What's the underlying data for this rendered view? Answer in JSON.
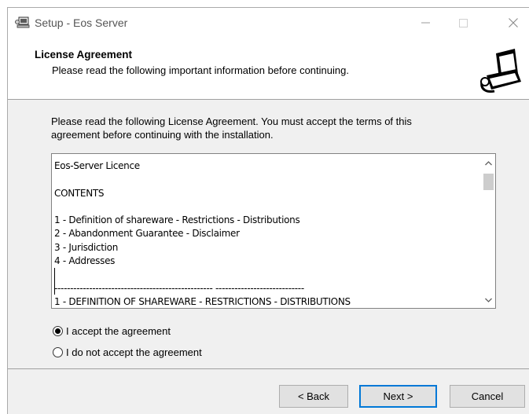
{
  "window": {
    "title": "Setup - Eos Server"
  },
  "header": {
    "title": "License Agreement",
    "subtitle": "Please read the following important information before continuing."
  },
  "intro": {
    "line1": "Please read the following License Agreement. You must accept the terms of this",
    "line2": "agreement before continuing with the installation."
  },
  "license_text": [
    "Eos-Server Licence",
    "",
    "CONTENTS",
    "",
    "1 - Definition of shareware - Restrictions - Distributions",
    "2 - Abandonment Guarantee - Disclaimer",
    "3 - Jurisdiction",
    "4 - Addresses",
    "",
    "-------------------------------------------------- ----------------------------",
    "1 - DEFINITION OF SHAREWARE - RESTRICTIONS - DISTRIBUTIONS"
  ],
  "radios": {
    "accept_label": "I accept the agreement",
    "decline_label": "I do not accept the agreement",
    "selected": "accept"
  },
  "buttons": {
    "back": "< Back",
    "next": "Next >",
    "cancel": "Cancel"
  },
  "icons": {
    "title_icon": "setup-computer-icon",
    "wizard_icon": "install-computer-icon",
    "minimize": "minimize-icon",
    "maximize": "maximize-icon",
    "close": "close-icon",
    "scroll_up": "chevron-up-icon",
    "scroll_down": "chevron-down-icon"
  },
  "colors": {
    "accent": "#0078d7",
    "header_bg": "#ffffff",
    "body_bg": "#f0f0f0"
  }
}
